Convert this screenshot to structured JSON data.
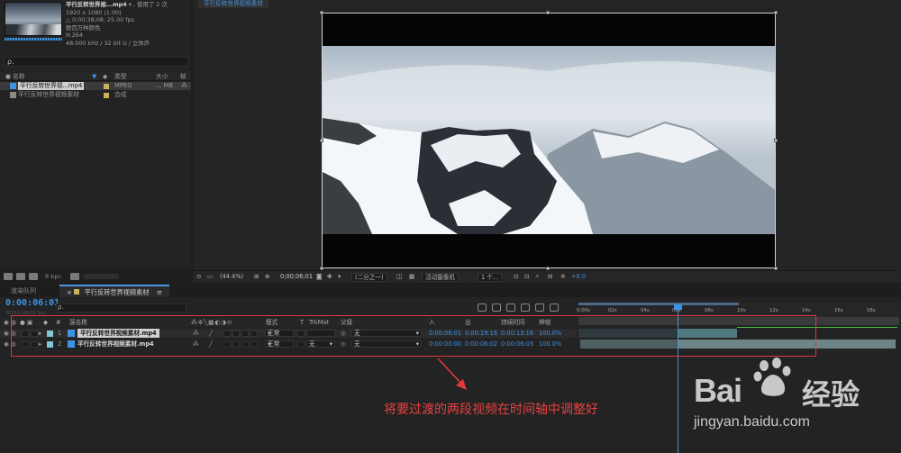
{
  "project": {
    "filename": "平行反转世界视...mp4",
    "usage": "▾ , 使用了 2 次",
    "resolution": "1920 x 1080 (1.00)",
    "duration": "△ 0;00;38;08, 25.00 fps",
    "colors": "数百万种颜色",
    "codec": "H.264",
    "audio": "48.000 kHz / 32 bit U / 立体声",
    "search_placeholder": "ρ.",
    "columns": {
      "name": "名称",
      "type": "类型",
      "size": "大小",
      "rate": "帧速"
    },
    "items": [
      {
        "name": "平行反转世界视...mp4",
        "type": "MPEG",
        "size": "... MB"
      },
      {
        "name": "平行反转世界视频素材",
        "type": "合成",
        "size": ""
      }
    ],
    "bpc": "8 bpc"
  },
  "viewer": {
    "tab": "平行反转世界视频素材",
    "zoom": "(44.4%)",
    "timecode": "0;00;06;01",
    "resolution": "(二分之一)",
    "camera": "活动摄像机",
    "views": "1 个...",
    "exposure": "+0.0"
  },
  "timeline": {
    "tabs": {
      "render_queue": "渲染队列",
      "comp": "平行反转世界视频素材"
    },
    "current_time": "0:00:06:01",
    "fps": "00151 (25.00 fps)",
    "ruler_ticks": [
      "0:00s",
      "02s",
      "04s",
      "06s",
      "08s",
      "10s",
      "12s",
      "14s",
      "16s",
      "18s"
    ],
    "columns": {
      "num": "#",
      "source": "源名称",
      "mode": "模式",
      "t": "T",
      "trkmat": "TrkMat",
      "parent": "父级",
      "in": "入",
      "out": "出",
      "duration": "持续时间",
      "stretch": "伸缩"
    },
    "layers": [
      {
        "num": "1",
        "name": "平行反转世界视频素材.mp4",
        "mode": "正常",
        "trkmat": "",
        "parent": "无",
        "in": "0:00:06:01",
        "out": "0:00:19:16",
        "duration": "0:00:13:16",
        "stretch": "100.0%"
      },
      {
        "num": "2",
        "name": "平行反转世界视频素材.mp4",
        "mode": "正常",
        "trkmat": "无",
        "parent": "无",
        "in": "0:00:00:00",
        "out": "0:00:06:02",
        "duration": "0:00:06:03",
        "stretch": "100.0%"
      }
    ]
  },
  "annotation": {
    "caption": "将要过渡的两段视频在时间轴中调整好"
  },
  "watermark": {
    "brand": "Bai",
    "brand_cn": "经验",
    "url": "jingyan.baidu.com"
  },
  "colors": {
    "accent": "#3d94e6",
    "annotation_red": "#e03a3a"
  }
}
